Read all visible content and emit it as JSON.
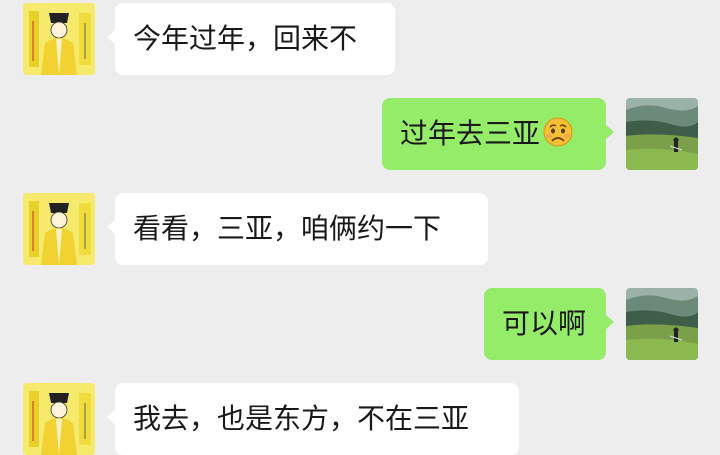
{
  "conversation": {
    "messages": [
      {
        "side": "incoming",
        "text": "今年过年，回来不"
      },
      {
        "side": "outgoing",
        "text": "过年去三亚",
        "emoji": "worried-face-emoji"
      },
      {
        "side": "incoming",
        "text": "看看，三亚，咱俩约一下"
      },
      {
        "side": "outgoing",
        "text": "可以啊"
      },
      {
        "side": "incoming",
        "text": "我去，也是东方，不在三亚"
      }
    ]
  },
  "colors": {
    "background": "#ededed",
    "incoming_bubble": "#ffffff",
    "outgoing_bubble": "#95ec69",
    "text": "#191919"
  },
  "icons": {
    "contact_avatar": "cartoon-scholar-avatar-icon",
    "self_avatar": "meadow-landscape-avatar-icon"
  }
}
